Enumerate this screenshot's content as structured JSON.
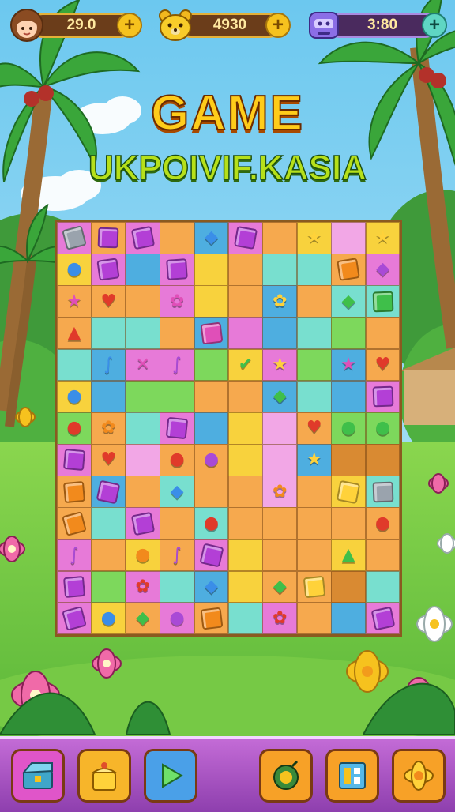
{
  "hud": {
    "player": {
      "value": "29.0",
      "avatar_icon": "girl-avatar-icon",
      "plus": "+"
    },
    "coins": {
      "value": "4930",
      "avatar_icon": "bear-icon",
      "plus": "+"
    },
    "gems": {
      "value": "3:80",
      "avatar_icon": "robot-icon",
      "plus": "+"
    }
  },
  "title": {
    "line1": "GAME",
    "line2": "UKPOIVIF.KASIA"
  },
  "board": {
    "cols": 10,
    "rows": 13,
    "palette": {
      "P": "#e77ad8",
      "O": "#f6a94e",
      "Y": "#f8d23d",
      "G": "#7dd85c",
      "C": "#78dfcf",
      "B": "#4eaee0",
      "K": "#f2a7e6",
      "T": "#d98a32",
      "L": "#b8e986"
    },
    "colors": [
      "POPOBPOYKY",
      "YPBPYOCCOP",
      "OOOPYOBOCC",
      "OCCOBPBCGO",
      "CBPPGYPGBO",
      "YBGGOOBCBP",
      "GOCPBYKOGG",
      "POKOOYKBTT",
      "OBOCOOKOYC",
      "OCPOCOOOOO",
      "POYOPYOOYO",
      "PGPCBYOOTC",
      "PYOPOCPOBP"
    ],
    "pieces": [
      "gem-gray",
      "gem-purple",
      "gem-purple",
      "",
      "fish-blue",
      "gem-purple",
      "",
      "star-yellow",
      "",
      "star-yellow",
      "drop-blue",
      "gem-purple",
      "",
      "gem-purple",
      "",
      "",
      "",
      "",
      "gem-orange",
      "cat-purple",
      "star-pink",
      "heart-red",
      "",
      "bird-pink",
      "",
      "",
      "flower-yellow",
      "",
      "leaf-green",
      "gem-green",
      "fire-red",
      "",
      "",
      "",
      "gem-pink",
      "",
      "",
      "",
      "",
      "",
      "",
      "worm-blue",
      "cross-pink",
      "worm-purple",
      "",
      "check-green",
      "star-yellow",
      "",
      "star-pink",
      "heart-red",
      "drop-blue",
      "",
      "",
      "",
      "",
      "",
      "leaf-green",
      "",
      "",
      "gem-purple",
      "fruit-red",
      "flower-orange",
      "",
      "gem-purple",
      "",
      "",
      "",
      "heart-red",
      "slime-green",
      "slime-green",
      "gem-purple",
      "heart-red",
      "",
      "apple-red",
      "pig-purple",
      "",
      "",
      "star-yellow",
      "",
      "",
      "gem-orange",
      "gem-purple",
      "",
      "fish-blue",
      "",
      "",
      "flower-orange",
      "",
      "gem-yellow",
      "gem-gray",
      "gem-orange",
      "",
      "gem-purple",
      "",
      "apple-red",
      "",
      "",
      "",
      "",
      "egg-red",
      "worm-purple",
      "",
      "bear-orange",
      "worm-purple",
      "gem-purple",
      "",
      "",
      "",
      "arrow-green",
      "",
      "gem-purple",
      "",
      "flower-red",
      "",
      "fish-blue",
      "",
      "leaf-green",
      "gem-yellow",
      "",
      "",
      "gem-purple",
      "drop-blue",
      "leaf-green",
      "pig-purple",
      "gem-orange",
      "",
      "flower-red",
      "",
      "",
      "gem-purple"
    ]
  },
  "toolbar": {
    "buttons": [
      {
        "name": "inventory-button",
        "icon": "chest-icon",
        "color": "#e055c9"
      },
      {
        "name": "shop-button",
        "icon": "gift-cake-icon",
        "color": "#f7b52a"
      },
      {
        "name": "play-button",
        "icon": "play-icon",
        "color": "#4aa0e8"
      },
      {
        "name": "bomb-button",
        "icon": "bomb-icon",
        "color": "#f7a127"
      },
      {
        "name": "map-button",
        "icon": "map-icon",
        "color": "#f7a127"
      },
      {
        "name": "settings-button",
        "icon": "flower-gear-icon",
        "color": "#f7a127"
      }
    ]
  }
}
